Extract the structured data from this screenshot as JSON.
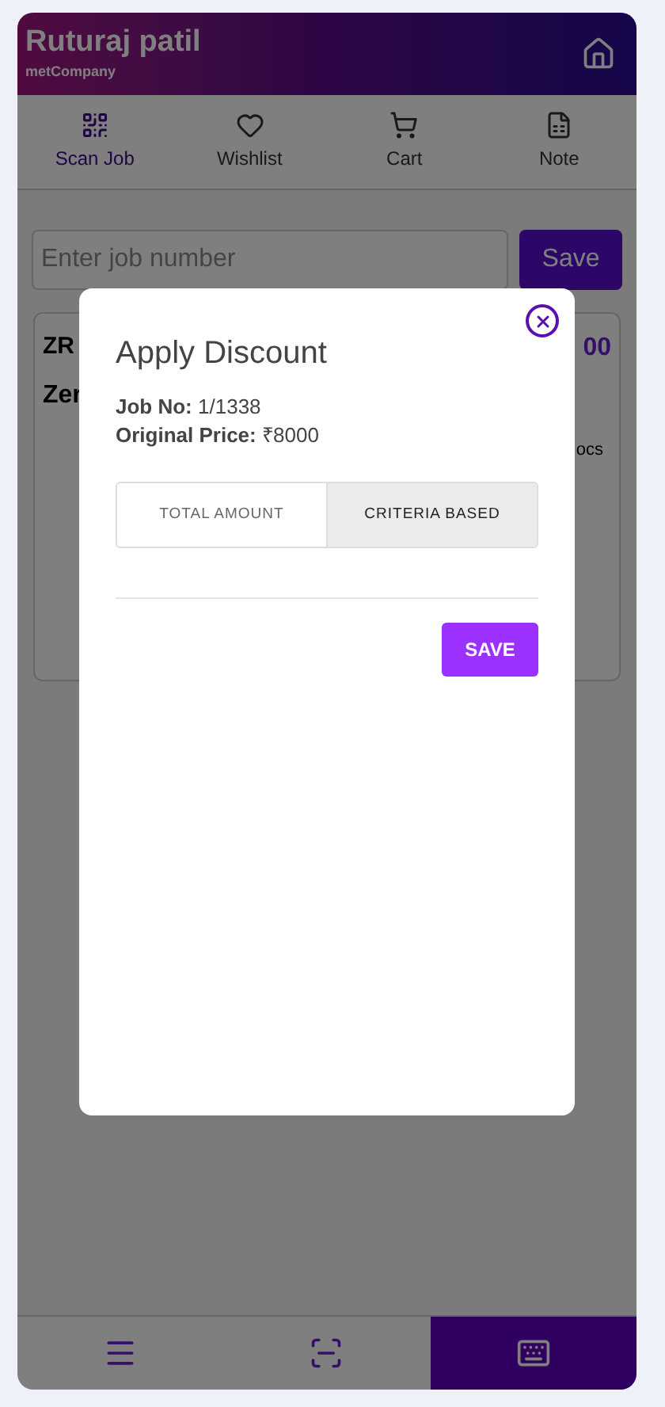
{
  "header": {
    "title": "Ruturaj patil",
    "subtitle": "metCompany"
  },
  "nav_tabs": [
    {
      "kind": "qr",
      "label": "Scan Job",
      "selected": true
    },
    {
      "kind": "heart",
      "label": "Wishlist",
      "selected": false
    },
    {
      "kind": "cart",
      "label": "Cart",
      "selected": false
    },
    {
      "kind": "note",
      "label": "Note",
      "selected": false
    }
  ],
  "job_field": {
    "placeholder": "Enter job number"
  },
  "save_button": "Save",
  "card": {
    "code": "ZR",
    "name": "Zer",
    "price": "00",
    "detail": "ocs"
  },
  "dialog": {
    "title": "Apply Discount",
    "job_label": "Job No:",
    "job_value": "1/1338",
    "price_label": "Original Price:",
    "price_value": "₹8000",
    "tabs": [
      {
        "label": "TOTAL AMOUNT",
        "selected": false
      },
      {
        "label": "CRITERIA BASED",
        "selected": true
      }
    ],
    "save": "SAVE"
  },
  "bottom_bar": [
    {
      "kind": "menu",
      "selected": false
    },
    {
      "kind": "scan",
      "selected": false
    },
    {
      "kind": "keyboard",
      "selected": true
    }
  ]
}
